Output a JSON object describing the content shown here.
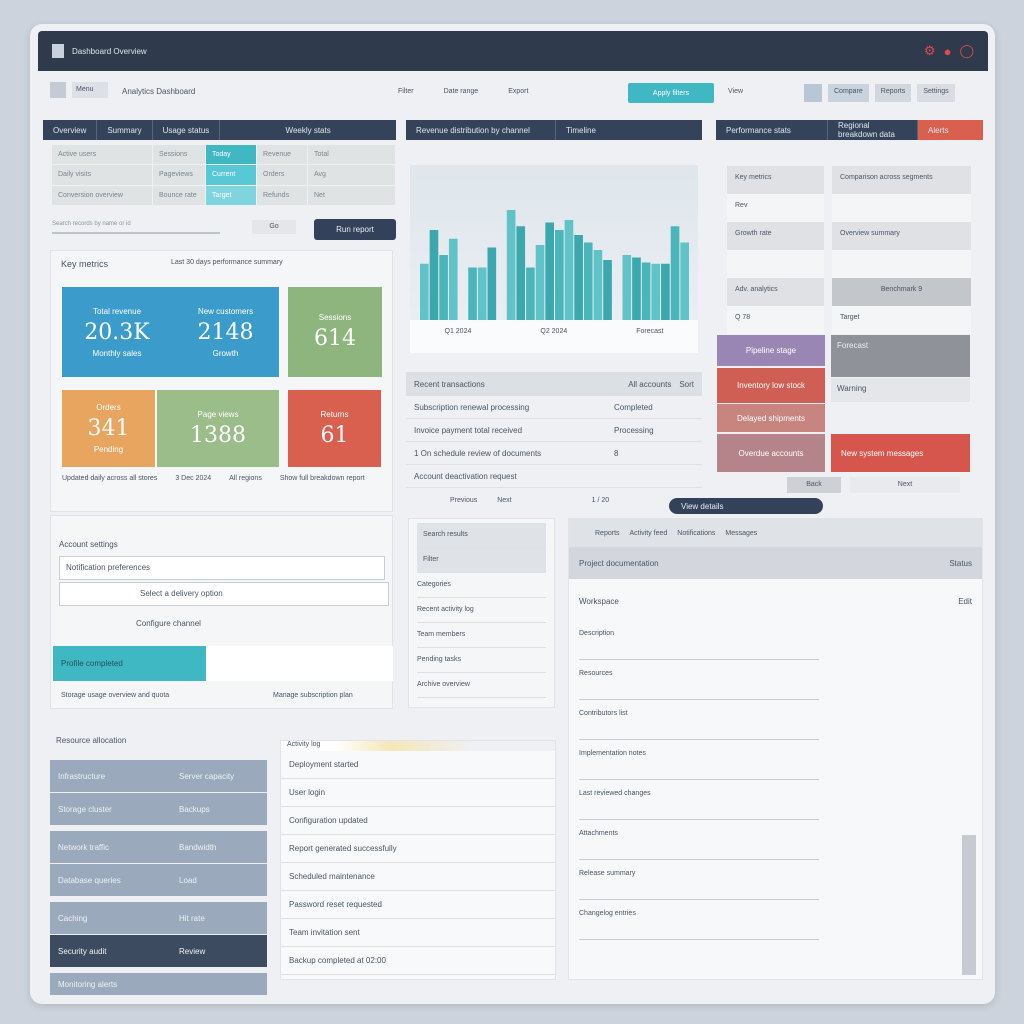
{
  "app": {
    "title": "Dashboard Overview",
    "logo": "dashboard-logo"
  },
  "toolbar": {
    "menu": "Menu",
    "breadcrumb": "Analytics Dashboard",
    "filters": [
      "Filter",
      "Date range",
      "Export"
    ],
    "primary": "Apply filters",
    "view": "View",
    "secondary": [
      "Compare",
      "Reports",
      "Settings"
    ]
  },
  "left_panel": {
    "tabs": [
      "Overview",
      "Summary",
      "Usage status",
      "Weekly stats"
    ],
    "grid": [
      [
        "Active users",
        "Sessions",
        "Today",
        "Revenue",
        "Total"
      ],
      [
        "Daily visits",
        "Pageviews",
        "Current",
        "Orders",
        "Avg"
      ],
      [
        "Conversion overview",
        "Bounce rate",
        "Target",
        "Refunds",
        "Net"
      ]
    ],
    "search_placeholder": "Search records by name or id",
    "search_hint": "Go",
    "button": "Run report"
  },
  "kpi": {
    "title": "Key metrics",
    "subtitle": "Last 30 days performance summary",
    "tiles": [
      {
        "label": "Total revenue",
        "value": "20.3K",
        "sub": "Monthly sales"
      },
      {
        "label": "New customers",
        "value": "2148",
        "sub": "Growth"
      },
      {
        "label": "Sessions",
        "value": "614",
        "sub": ""
      },
      {
        "label": "Orders",
        "value": "341",
        "sub": "Pending"
      },
      {
        "label": "Page views",
        "value": "1388",
        "sub": ""
      },
      {
        "label": "Returns",
        "value": "61",
        "sub": ""
      }
    ],
    "footer": [
      "Updated daily across all stores",
      "3 Dec 2024",
      "All regions",
      "Show full breakdown report"
    ]
  },
  "chart_panel": {
    "tabs": [
      "Revenue distribution by channel",
      "Timeline"
    ],
    "legend": [
      "Q1 2024",
      "Q2 2024",
      "Forecast"
    ],
    "chart_data": {
      "type": "bar",
      "values": [
        45,
        72,
        52,
        65,
        0,
        42,
        42,
        58,
        0,
        88,
        75,
        42,
        60,
        78,
        72,
        80,
        68,
        62,
        56,
        48,
        0,
        52,
        50,
        46,
        45,
        45,
        75,
        62
      ]
    }
  },
  "list_panel": {
    "header": "Recent transactions",
    "header_right": [
      "All accounts",
      "Sort"
    ],
    "items": [
      {
        "label": "Subscription renewal processing",
        "value": "Completed"
      },
      {
        "label": "Invoice payment total received",
        "value": "Processing"
      },
      {
        "label": "1 On schedule review of documents",
        "value": "8"
      },
      {
        "label": "Account deactivation request",
        "value": ""
      }
    ],
    "footer": [
      "Previous",
      "Next",
      "1 / 20"
    ]
  },
  "right_panel": {
    "tabs": [
      "Performance stats",
      "Regional breakdown data",
      "Alerts"
    ],
    "left_cells": [
      "Key metrics",
      "Rev",
      "Growth rate",
      "",
      "Adv. analytics",
      "Q 78"
    ],
    "right_cells": [
      "Comparison across segments",
      "",
      "Overview summary",
      "",
      "Benchmark 9",
      "Target"
    ],
    "colored_left": [
      "Pipeline stage",
      "Inventory low stock",
      "Delayed shipments",
      "Overdue accounts"
    ],
    "colored_right": [
      "Forecast",
      "Warning",
      "New system messages"
    ],
    "pager": [
      "Back",
      "Next"
    ]
  },
  "pill_button": "View details",
  "form_panel": {
    "title": "Account settings",
    "field1": "Notification preferences",
    "field2": "Select a delivery option",
    "link": "Configure channel",
    "progress_label": "Profile completed",
    "progress": 45,
    "footer": [
      "Storage usage overview and quota",
      "Manage subscription plan"
    ]
  },
  "mid_list": {
    "items": [
      "Search results",
      "Filter",
      "Categories",
      "Recent activity log",
      "Team members",
      "Pending tasks",
      "Archive overview"
    ]
  },
  "detail_panel": {
    "tabs": [
      "Reports",
      "Activity feed",
      "Notifications",
      "Messages"
    ],
    "header": "Project documentation",
    "header_right": "Status",
    "section": "Workspace",
    "section_right": "Edit",
    "rows": [
      "Description",
      "Resources",
      "Contributors list",
      "Implementation notes",
      "Last reviewed changes",
      "Attachments",
      "Release summary",
      "Changelog entries"
    ]
  },
  "bottom_left": {
    "title": "Resource allocation",
    "rows": [
      [
        "Infrastructure",
        "Server capacity"
      ],
      [
        "Storage cluster",
        "Backups"
      ],
      [
        "Network traffic",
        "Bandwidth"
      ],
      [
        "Database queries",
        "Load"
      ],
      [
        "Caching",
        "Hit rate"
      ],
      [
        "Security audit",
        "Review"
      ],
      [
        "Monitoring alerts",
        ""
      ]
    ]
  },
  "bottom_mid": {
    "title": "Activity log",
    "rows": [
      "Deployment started",
      "User login",
      "Configuration updated",
      "Report generated successfully",
      "Scheduled maintenance",
      "Password reset requested",
      "Team invitation sent",
      "Backup completed at 02:00"
    ]
  },
  "colors": {
    "topbar": "#2f3b4d",
    "teal": "#3fb8c4",
    "blue": "#3b9ccc",
    "green": "#8fb57f",
    "orange": "#e8a55f",
    "red": "#d9604f",
    "purple": "#9a86b4"
  }
}
